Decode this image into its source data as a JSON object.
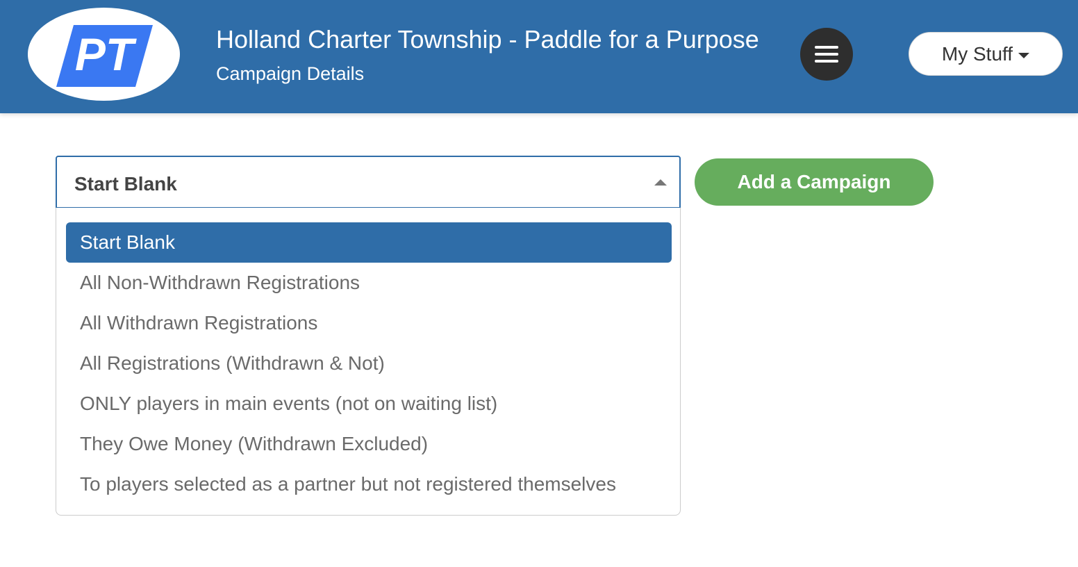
{
  "header": {
    "logo_text": "PT",
    "title": "Holland Charter Township - Paddle for a Purpose",
    "subtitle": "Campaign Details",
    "menu_icon": "hamburger-icon",
    "my_stuff_label": "My Stuff"
  },
  "colors": {
    "header_bg": "#2f6da8",
    "accent_blue": "#2f6da8",
    "logo_blue": "#3a78f2",
    "add_button_green": "#66ad5d",
    "menu_button_bg": "#2e2e2e"
  },
  "campaign_select": {
    "selected_value": "Start Blank",
    "options": [
      "Start Blank",
      "All Non-Withdrawn Registrations",
      "All Withdrawn Registrations",
      "All Registrations (Withdrawn & Not)",
      "ONLY players in main events (not on waiting list)",
      "They Owe Money (Withdrawn Excluded)",
      "To players selected as a partner but not registered themselves"
    ],
    "highlighted_option": "Start Blank"
  },
  "add_campaign_label": "Add a Campaign"
}
